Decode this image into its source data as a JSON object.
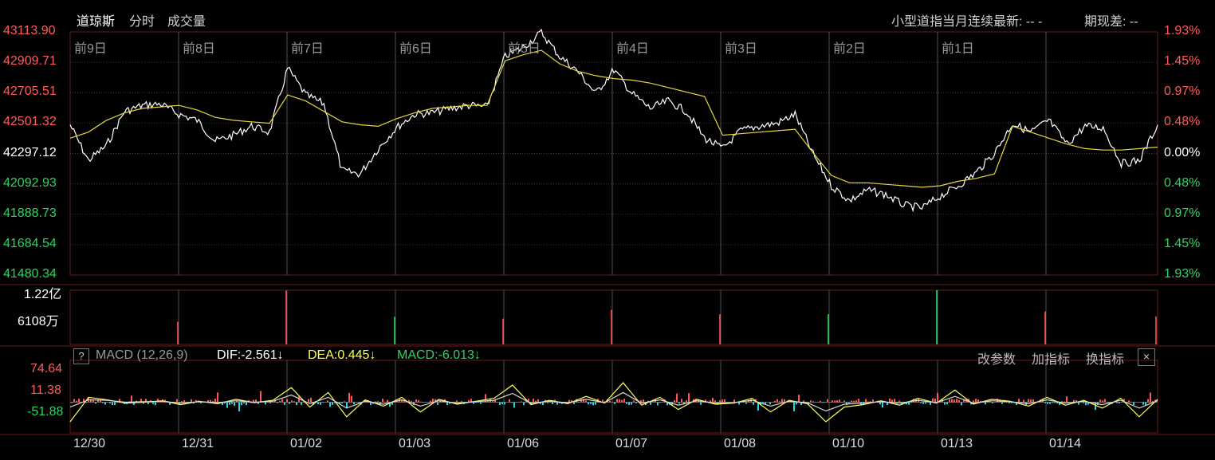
{
  "header": {
    "tabs": [
      "道琼斯",
      "分时",
      "成交量"
    ],
    "status_left": "小型道指当月连续最新: --  -",
    "status_right": "期现差: --"
  },
  "price_axis": {
    "left_labels": [
      "43113.90",
      "42909.71",
      "42705.51",
      "42501.32",
      "42297.12",
      "42092.93",
      "41888.73",
      "41684.54",
      "41480.34"
    ],
    "right_labels": [
      "1.93%",
      "1.45%",
      "0.97%",
      "0.48%",
      "0.00%",
      "0.48%",
      "0.97%",
      "1.45%",
      "1.93%"
    ]
  },
  "day_labels": [
    "前9日",
    "前8日",
    "前7日",
    "前6日",
    "前5日",
    "前4日",
    "前3日",
    "前2日",
    "前1日"
  ],
  "volume_axis": {
    "top": "1.22亿",
    "mid": "6108万"
  },
  "macd": {
    "title": "MACD (12,26,9)",
    "dif": "DIF:-2.561↓",
    "dea": "DEA:0.445↓",
    "macd": "MACD:-6.013↓",
    "axis": [
      "74.64",
      "11.38",
      "-51.88"
    ],
    "buttons": [
      "改参数",
      "加指标",
      "换指标"
    ],
    "help": "?",
    "close": "×"
  },
  "x_labels": [
    "12/30",
    "12/31",
    "01/02",
    "01/03",
    "01/06",
    "01/07",
    "01/08",
    "01/10",
    "01/13",
    "01/14"
  ],
  "chart_data": [
    {
      "type": "line",
      "title": "道琼斯 分时",
      "ylim": [
        41480.34,
        43113.9
      ],
      "base": 42297.12,
      "series": [
        {
          "name": "price",
          "color": "#ffffff",
          "values": [
            42490,
            42250,
            42350,
            42580,
            42620,
            42630,
            42560,
            42520,
            42380,
            42420,
            42480,
            42440,
            42870,
            42690,
            42630,
            42180,
            42160,
            42330,
            42470,
            42560,
            42570,
            42600,
            42620,
            42610,
            42950,
            43010,
            43110,
            42950,
            42850,
            42700,
            42860,
            42700,
            42600,
            42650,
            42580,
            42400,
            42330,
            42450,
            42480,
            42500,
            42560,
            42290,
            42080,
            41980,
            42050,
            42020,
            41950,
            41930,
            42010,
            42080,
            42170,
            42300,
            42500,
            42440,
            42520,
            42360,
            42480,
            42470,
            42230,
            42250,
            42490
          ]
        },
        {
          "name": "avg",
          "color": "#e6d83a",
          "values": [
            42400,
            42440,
            42520,
            42570,
            42600,
            42610,
            42620,
            42590,
            42540,
            42520,
            42510,
            42500,
            42690,
            42650,
            42580,
            42510,
            42490,
            42480,
            42530,
            42570,
            42600,
            42610,
            42620,
            42620,
            42920,
            42960,
            42990,
            42900,
            42850,
            42820,
            42800,
            42790,
            42770,
            42740,
            42710,
            42680,
            42420,
            42430,
            42440,
            42450,
            42460,
            42300,
            42150,
            42100,
            42100,
            42090,
            42080,
            42070,
            42080,
            42110,
            42130,
            42160,
            42480,
            42440,
            42400,
            42360,
            42330,
            42320,
            42320,
            42330,
            42340
          ]
        }
      ]
    },
    {
      "type": "bar",
      "title": "成交量",
      "ylim": [
        0,
        12200
      ],
      "spikes": [
        5100,
        12100,
        6200,
        5800,
        7800,
        6800,
        6800,
        12200,
        7400,
        6300
      ]
    },
    {
      "type": "line",
      "title": "MACD (12,26,9)",
      "ylim": [
        -63,
        86
      ],
      "series": [
        {
          "name": "DIF",
          "color": "#ffff55",
          "values": [
            -40,
            10,
            5,
            -2,
            0,
            3,
            -5,
            2,
            -3,
            6,
            -1,
            4,
            30,
            -10,
            20,
            -30,
            5,
            -8,
            10,
            -20,
            6,
            -4,
            2,
            8,
            35,
            -5,
            4,
            -3,
            12,
            -2,
            40,
            -6,
            10,
            -15,
            6,
            -4,
            -2,
            8,
            -20,
            4,
            -3,
            -40,
            -10,
            -5,
            3,
            -6,
            8,
            -2,
            25,
            -4,
            6,
            2,
            -8,
            10,
            -6,
            4,
            -12,
            8,
            -30,
            6
          ]
        },
        {
          "name": "DEA",
          "color": "#d8d8d8",
          "values": [
            -10,
            5,
            4,
            0,
            1,
            2,
            -2,
            1,
            -1,
            3,
            0,
            2,
            15,
            -3,
            10,
            -12,
            2,
            -4,
            5,
            -8,
            3,
            -2,
            1,
            4,
            18,
            -2,
            2,
            -1,
            6,
            -1,
            20,
            -2,
            5,
            -6,
            3,
            -2,
            -1,
            4,
            -8,
            2,
            -1,
            -18,
            -4,
            -2,
            1,
            -2,
            4,
            -1,
            12,
            -2,
            3,
            1,
            -3,
            5,
            -2,
            2,
            -5,
            4,
            -12,
            3
          ]
        }
      ]
    }
  ]
}
